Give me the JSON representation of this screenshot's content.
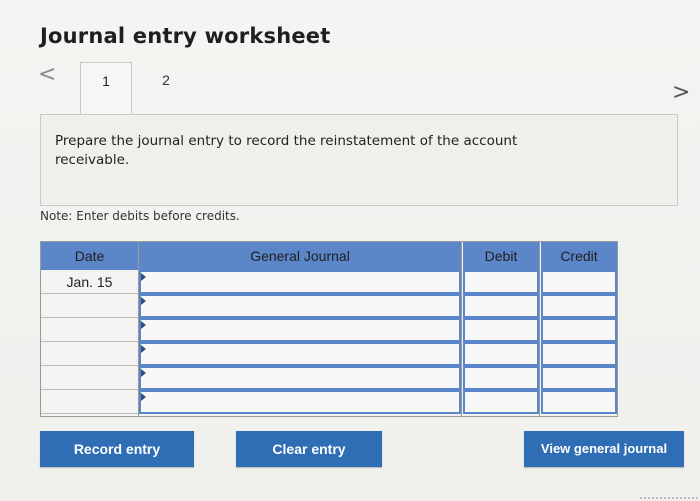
{
  "header": {
    "title": "Journal entry worksheet"
  },
  "tabs": [
    {
      "label": "1"
    },
    {
      "label": "2"
    }
  ],
  "nav": {
    "prev_icon": "<",
    "next_icon": ">"
  },
  "panel": {
    "instruction": "Prepare the journal entry to record the reinstatement of the account receivable."
  },
  "note": "Note: Enter debits before credits.",
  "table": {
    "headers": [
      "Date",
      "General Journal",
      "Debit",
      "Credit"
    ],
    "rows": [
      {
        "date": "Jan. 15",
        "account": "",
        "debit": "",
        "credit": ""
      },
      {
        "date": "",
        "account": "",
        "debit": "",
        "credit": ""
      },
      {
        "date": "",
        "account": "",
        "debit": "",
        "credit": ""
      },
      {
        "date": "",
        "account": "",
        "debit": "",
        "credit": ""
      },
      {
        "date": "",
        "account": "",
        "debit": "",
        "credit": ""
      },
      {
        "date": "",
        "account": "",
        "debit": "",
        "credit": ""
      }
    ]
  },
  "buttons": {
    "record": "Record entry",
    "clear": "Clear entry",
    "view": "View general journal"
  },
  "colors": {
    "header_blue": "#5b86c9",
    "button_blue": "#2f6eb5"
  }
}
